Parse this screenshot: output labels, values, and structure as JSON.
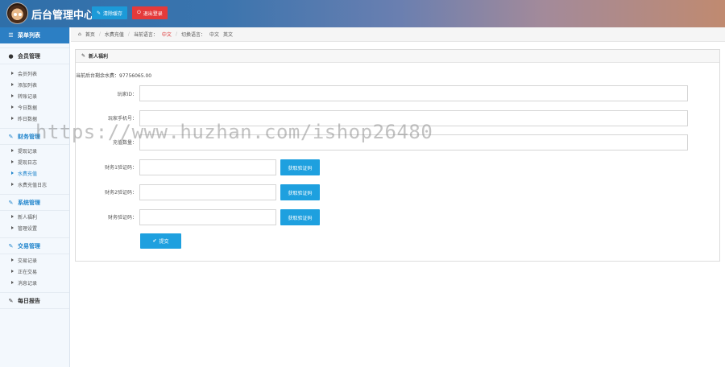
{
  "header": {
    "title": "后台管理中心",
    "clear_cache_label": "清除缓存",
    "logout_label": "退出登录"
  },
  "sidebar": {
    "menu_title": "菜单列表",
    "groups": [
      {
        "label": "会员管理",
        "icon": "user-icon",
        "items": [
          "会员列表",
          "添加列表",
          "转账记录",
          "今日数据",
          "昨日数据"
        ]
      },
      {
        "label": "财务管理",
        "icon": "edit-icon",
        "items": [
          "提现记录",
          "提现日志",
          "水费充值",
          "水费充值日志"
        ],
        "active_index": 2
      },
      {
        "label": "系统管理",
        "icon": "edit-icon",
        "items": [
          "新人福利",
          "管理设置"
        ]
      },
      {
        "label": "交易管理",
        "icon": "edit-icon",
        "items": [
          "交易记录",
          "正在交易",
          "消息记录"
        ]
      },
      {
        "label": "每日报告",
        "icon": "edit-icon",
        "items": []
      }
    ]
  },
  "breadcrumb": {
    "home": "首页",
    "current": "水费充值",
    "lang_label_1": "当前语言：",
    "lang_value_1": "中文",
    "lang_label_2": "切换语言：",
    "lang_value_2": "中文",
    "lang_alt": "英文"
  },
  "panel": {
    "title": "新人福利",
    "balance_text": "当前后台剩余水费：97756065.00"
  },
  "form": {
    "player_id_label": "玩家ID：",
    "player_phone_label": "玩家手机号：",
    "recharge_amount_label": "充值数量：",
    "code1_label": "财务1验证码：",
    "code2_label": "财务2验证码：",
    "code3_label": "财务验证码：",
    "get_code_label": "获取验证码",
    "submit_label": "提交"
  },
  "watermark": "https://www.huzhan.com/ishop26480",
  "colors": {
    "primary": "#1ea0df",
    "danger": "#e43a3a",
    "menu_head": "#2c7fc4"
  }
}
